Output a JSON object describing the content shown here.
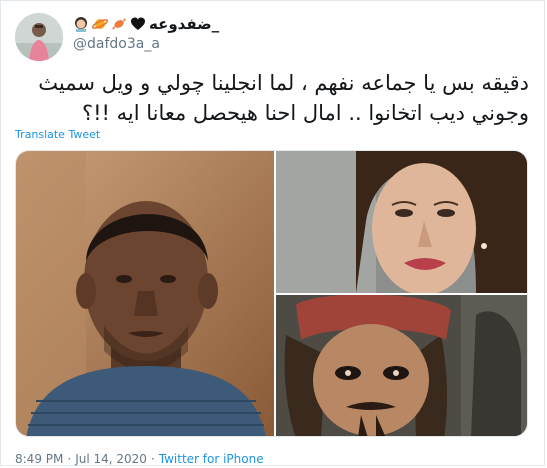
{
  "user": {
    "display_name": "ضفدوعه_",
    "handle": "@dafdo3a_a",
    "name_emojis": [
      "black-heart",
      "wrapped-candy",
      "orange-saturn",
      "woman-emoji"
    ]
  },
  "tweet": {
    "text_line1": "دقيقه بس يا جماعه نفهم ، لما انجلينا چولي و ويل سميث",
    "text_line2": "وجوني ديب اتخانوا .. امال احنا هيحصل معانا ايه !!؟",
    "translate_label": "Translate Tweet"
  },
  "media": [
    {
      "label": "photo-will-smith"
    },
    {
      "label": "photo-angelina-jolie"
    },
    {
      "label": "photo-johnny-depp-pirate"
    }
  ],
  "meta": {
    "time": "8:49 PM",
    "date": "Jul 14, 2020",
    "separator": "·",
    "source": "Twitter for iPhone"
  },
  "colors": {
    "link": "#1b95e0",
    "secondary_text": "#657786",
    "border": "#e1e8ed"
  }
}
